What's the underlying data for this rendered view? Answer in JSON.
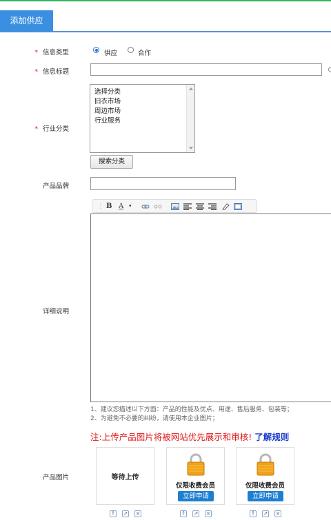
{
  "tab": {
    "label": "添加供应"
  },
  "form": {
    "info_type": {
      "label": "信息类型",
      "required_mark": "*",
      "options": [
        "供应",
        "合作"
      ],
      "selected": "供应"
    },
    "title": {
      "label": "信息标题",
      "required_mark": "*",
      "value": ""
    },
    "category": {
      "label": "行业分类",
      "required_mark": "*",
      "options": [
        "选择分类",
        "旧衣市场",
        "周边市场",
        "行业服务"
      ],
      "search_button": "搜索分类"
    },
    "brand": {
      "label": "产品品牌",
      "value": ""
    },
    "detail": {
      "label": "详细说明",
      "toolbar": {
        "bold": "B",
        "font_color": "A"
      },
      "tips": [
        "1、建议您描述以下方面：产品的性能及优点、用途、售后服务、包装等；",
        "2、为避免不必要的纠纷，请使用本企业图片；"
      ]
    },
    "images": {
      "label": "产品图片",
      "notice": "注:上传产品图片将被网站优先展示和审核!",
      "notice_link": "了解规则",
      "slots": [
        {
          "status": "等待上传"
        },
        {
          "status": "仅限收费会员",
          "action": "立即申请"
        },
        {
          "status": "仅限收费会员",
          "action": "立即申请"
        }
      ]
    }
  },
  "colors": {
    "tab_bg": "#3b8fe0",
    "required": "#e02020",
    "notice": "#e01818",
    "link": "#1a3ccc",
    "apply_bg": "#1e7fd1",
    "lock": "#f0a21a"
  }
}
